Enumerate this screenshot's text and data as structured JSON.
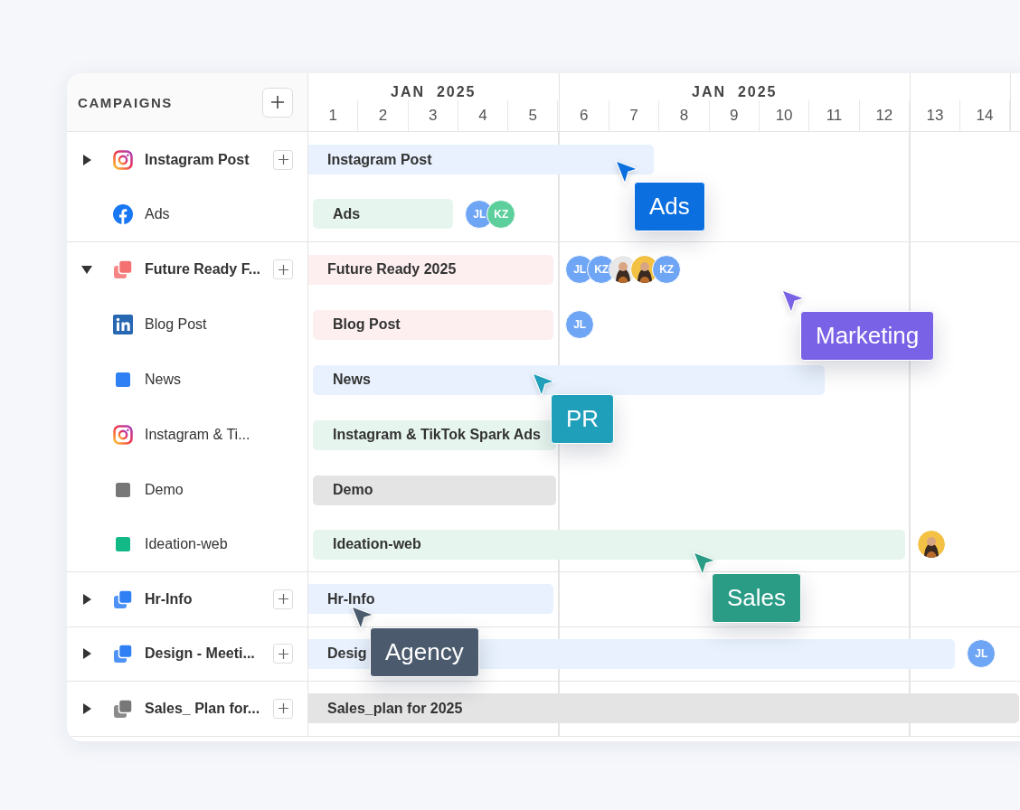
{
  "header": {
    "title": "CAMPAIGNS"
  },
  "months": [
    {
      "label": "JAN  2025",
      "days": [
        "1",
        "2",
        "3",
        "4",
        "5"
      ]
    },
    {
      "label": "JAN  2025",
      "days": [
        "6",
        "7",
        "8",
        "9",
        "10",
        "11",
        "12"
      ]
    },
    {
      "days": [
        "13",
        "14"
      ]
    }
  ],
  "groups": [
    {
      "name": "Instagram Post",
      "expanded": false,
      "icon": {
        "kind": "instagram"
      },
      "bar": {
        "label": "Instagram Post",
        "level": 0.486,
        "color": "#e8f1fd"
      },
      "children": [
        {
          "name": "Ads",
          "icon": {
            "kind": "facebook"
          },
          "bar": {
            "label": "Ads",
            "level": 0.204,
            "color": "#e6f6ee"
          },
          "avatars": [
            {
              "kind": "initials",
              "text": "JL",
              "color": "#6fa5f5"
            },
            {
              "kind": "initials",
              "text": "KZ",
              "color": "#5ccf9c"
            }
          ]
        }
      ]
    },
    {
      "name": "Future Ready F...",
      "expanded": true,
      "icon": {
        "kind": "stack",
        "color": "#f47171"
      },
      "bar": {
        "label": "Future Ready 2025",
        "level": 0.345,
        "color": "#fdefef"
      },
      "avatars": [
        {
          "kind": "initials",
          "text": "JL",
          "color": "#6fa5f5"
        },
        {
          "kind": "initials",
          "text": "KZ",
          "color": "#6fa5f5"
        },
        {
          "kind": "photo",
          "color": "#e8e8e8"
        },
        {
          "kind": "photo",
          "color": "#f3c244"
        },
        {
          "kind": "initials",
          "text": "KZ",
          "color": "#6fa5f5"
        }
      ],
      "children": [
        {
          "name": "Blog Post",
          "icon": {
            "kind": "linkedin"
          },
          "bar": {
            "label": "Blog Post",
            "level": 0.345,
            "color": "#fdefef"
          },
          "avatars": [
            {
              "kind": "initials",
              "text": "JL",
              "color": "#6fa5f5"
            }
          ]
        },
        {
          "name": "News",
          "icon": {
            "kind": "square",
            "color": "#2f7ff5"
          },
          "bar": {
            "label": "News",
            "level": 0.726,
            "color": "#e8f1fd"
          }
        },
        {
          "name": "Instagram & Ti...",
          "icon": {
            "kind": "instagram"
          },
          "bar": {
            "label": "Instagram & TikTok Spark Ads",
            "level": 0.349,
            "color": "#e6f6ee"
          }
        },
        {
          "name": "Demo",
          "icon": {
            "kind": "square",
            "color": "#777777"
          },
          "bar": {
            "label": "Demo",
            "level": 0.349,
            "color": "#e4e4e4"
          }
        },
        {
          "name": "Ideation-web",
          "icon": {
            "kind": "square",
            "color": "#12b886"
          },
          "bar": {
            "label": "Ideation-web",
            "level": 0.84,
            "color": "#e6f6ee"
          },
          "avatars": [
            {
              "kind": "photo",
              "color": "#f3c244"
            }
          ]
        }
      ]
    },
    {
      "name": "Hr-Info",
      "expanded": false,
      "icon": {
        "kind": "stack",
        "color": "#2f7ff5"
      },
      "bar": {
        "label": "Hr-Info",
        "level": 0.345,
        "color": "#e8f1fd"
      }
    },
    {
      "name": "Design - Meeti...",
      "expanded": false,
      "icon": {
        "kind": "stack",
        "color": "#2f7ff5"
      },
      "bar": {
        "label": "Desig",
        "level": 0.91,
        "color": "#e8f1fd"
      },
      "avatars": [
        {
          "kind": "initials",
          "text": "JL",
          "color": "#6fa5f5"
        }
      ]
    },
    {
      "name": "Sales_ Plan for...",
      "expanded": false,
      "icon": {
        "kind": "stack",
        "color": "#777777"
      },
      "bar": {
        "label": "Sales_plan for 2025",
        "level": 1,
        "color": "#e4e4e4"
      }
    }
  ],
  "cursors": [
    {
      "label": "Ads",
      "color": "#0b6fe0"
    },
    {
      "label": "Marketing",
      "color": "#7a62e6"
    },
    {
      "label": "PR",
      "color": "#1f9fba"
    },
    {
      "label": "Sales",
      "color": "#2a9c86"
    },
    {
      "label": "Agency",
      "color": "#4b5b6d"
    }
  ]
}
